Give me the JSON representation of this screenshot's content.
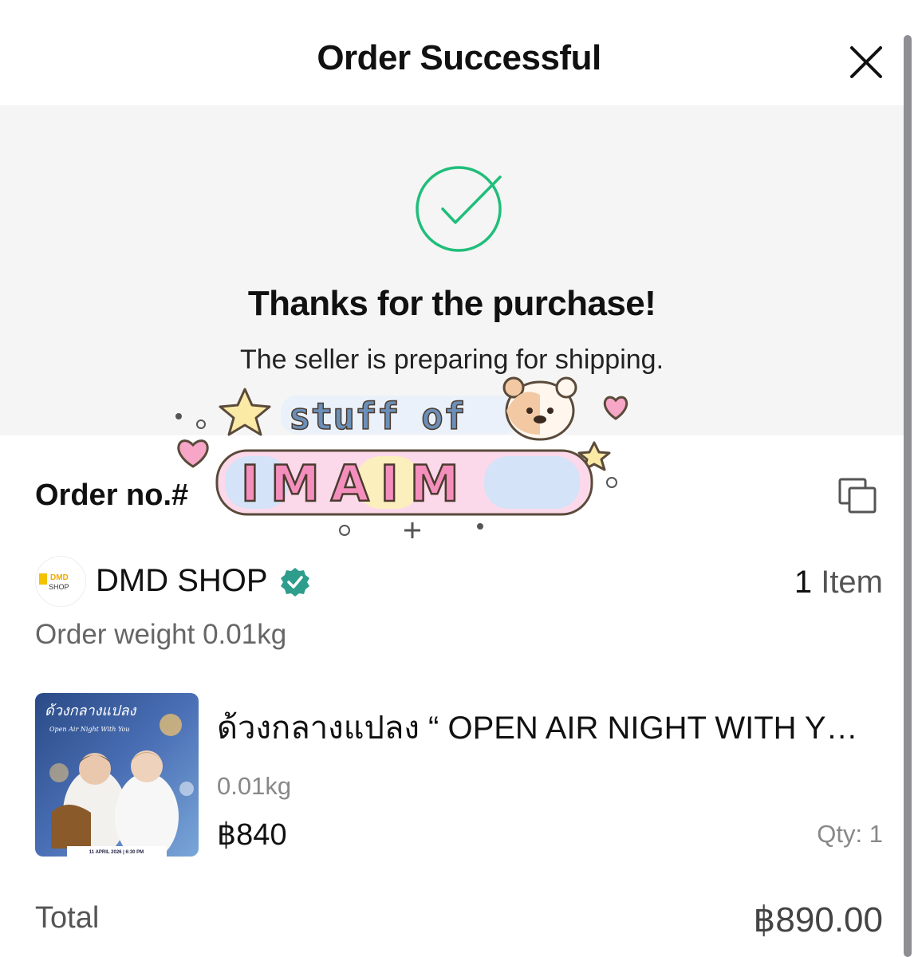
{
  "header": {
    "title": "Order Successful",
    "close_icon": "close-icon"
  },
  "success": {
    "icon": "check-circle-icon",
    "icon_color": "#1fbe7a",
    "title": "Thanks for the purchase!",
    "subtitle": "The seller is preparing for shipping."
  },
  "watermark": {
    "line1": "stuff of",
    "line2": "IMAIM"
  },
  "order": {
    "number_label": "Order no.#",
    "copy_icon": "copy-icon"
  },
  "shop": {
    "logo_text_top": "DMD",
    "logo_text_bottom": "SHOP",
    "name": "DMD SHOP",
    "verified_icon": "verified-badge-icon",
    "verified_color": "#2e9d8c",
    "item_count": "1",
    "item_label": "Item"
  },
  "weight": {
    "label": "Order weight 0.01kg"
  },
  "product": {
    "title": "ด้วงกลางแปลง “ OPEN AIR NIGHT WITH YOU",
    "weight": "0.01kg",
    "price": "฿840",
    "qty": "Qty: 1",
    "thumb_title": "ด้วงกลางแปลง",
    "thumb_subtitle": "Open Air Night With You",
    "thumb_date": "11 APRIL 2026 | 6:30 PM"
  },
  "total": {
    "label": "Total",
    "value": "฿890.00"
  }
}
